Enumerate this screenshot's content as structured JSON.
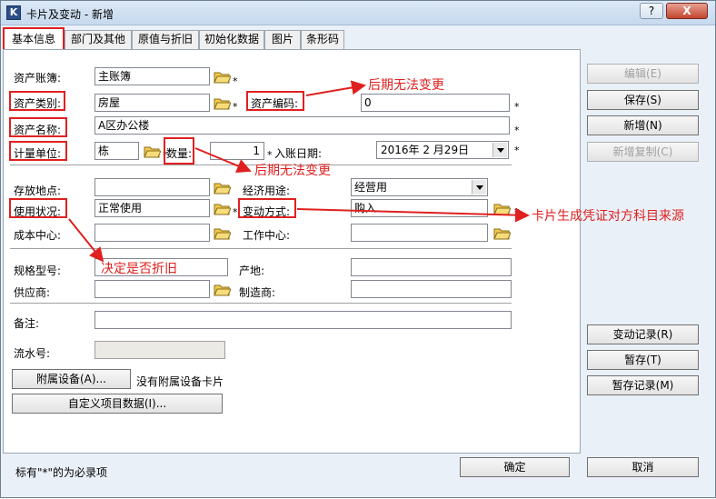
{
  "window": {
    "title": "卡片及变动 - 新增",
    "help_label": "?",
    "close_label": "X",
    "icon_label": "K"
  },
  "tabs": [
    {
      "label": "基本信息"
    },
    {
      "label": "部门及其他"
    },
    {
      "label": "原值与折旧"
    },
    {
      "label": "初始化数据"
    },
    {
      "label": "图片"
    },
    {
      "label": "条形码"
    }
  ],
  "form": {
    "book_label": "资产账簿:",
    "book_value": "主账簿",
    "category_label": "资产类别:",
    "category_value": "房屋",
    "code_label": "资产编码:",
    "code_value": "0",
    "name_label": "资产名称:",
    "name_value": "A区办公楼",
    "unit_label": "计量单位:",
    "unit_value": "栋",
    "qty_label": "数量:",
    "qty_value": "1",
    "date_label": "入账日期:",
    "date_value": "2016年  2 月29日",
    "location_label": "存放地点:",
    "location_value": "",
    "purpose_label": "经济用途:",
    "purpose_value": "经营用",
    "status_label": "使用状况:",
    "status_value": "正常使用",
    "change_label": "变动方式:",
    "change_value": "购入",
    "cost_center_label": "成本中心:",
    "cost_center_value": "",
    "work_center_label": "工作中心:",
    "work_center_value": "",
    "spec_label": "规格型号:",
    "spec_value": "",
    "origin_label": "产地:",
    "origin_value": "",
    "supplier_label": "供应商:",
    "supplier_value": "",
    "maker_label": "制造商:",
    "maker_value": "",
    "remark_label": "备注:",
    "remark_value": "",
    "serial_label": "流水号:",
    "serial_value": "",
    "attach_button": "附属设备(A)...",
    "attach_note": "没有附属设备卡片",
    "custom_button": "自定义项目数据(I)...",
    "star": "*"
  },
  "side_buttons": {
    "edit": "编辑(E)",
    "save": "保存(S)",
    "new": "新增(N)",
    "copy": "新增复制(C)",
    "history": "变动记录(R)",
    "temp_save": "暂存(T)",
    "temp_records": "暂存记录(M)"
  },
  "footer": {
    "note": "标有\"*\"的为必录项",
    "ok": "确定",
    "cancel": "取消"
  },
  "annotations": {
    "code_note": "后期无法变更",
    "qty_note": "后期无法变更",
    "change_note": "卡片生成凭证对方科目来源",
    "status_note": "决定是否折旧"
  },
  "colors": {
    "annotation": "#e02020",
    "panel_bg": "#ffffff",
    "window_bg": "#eaf0f7"
  }
}
